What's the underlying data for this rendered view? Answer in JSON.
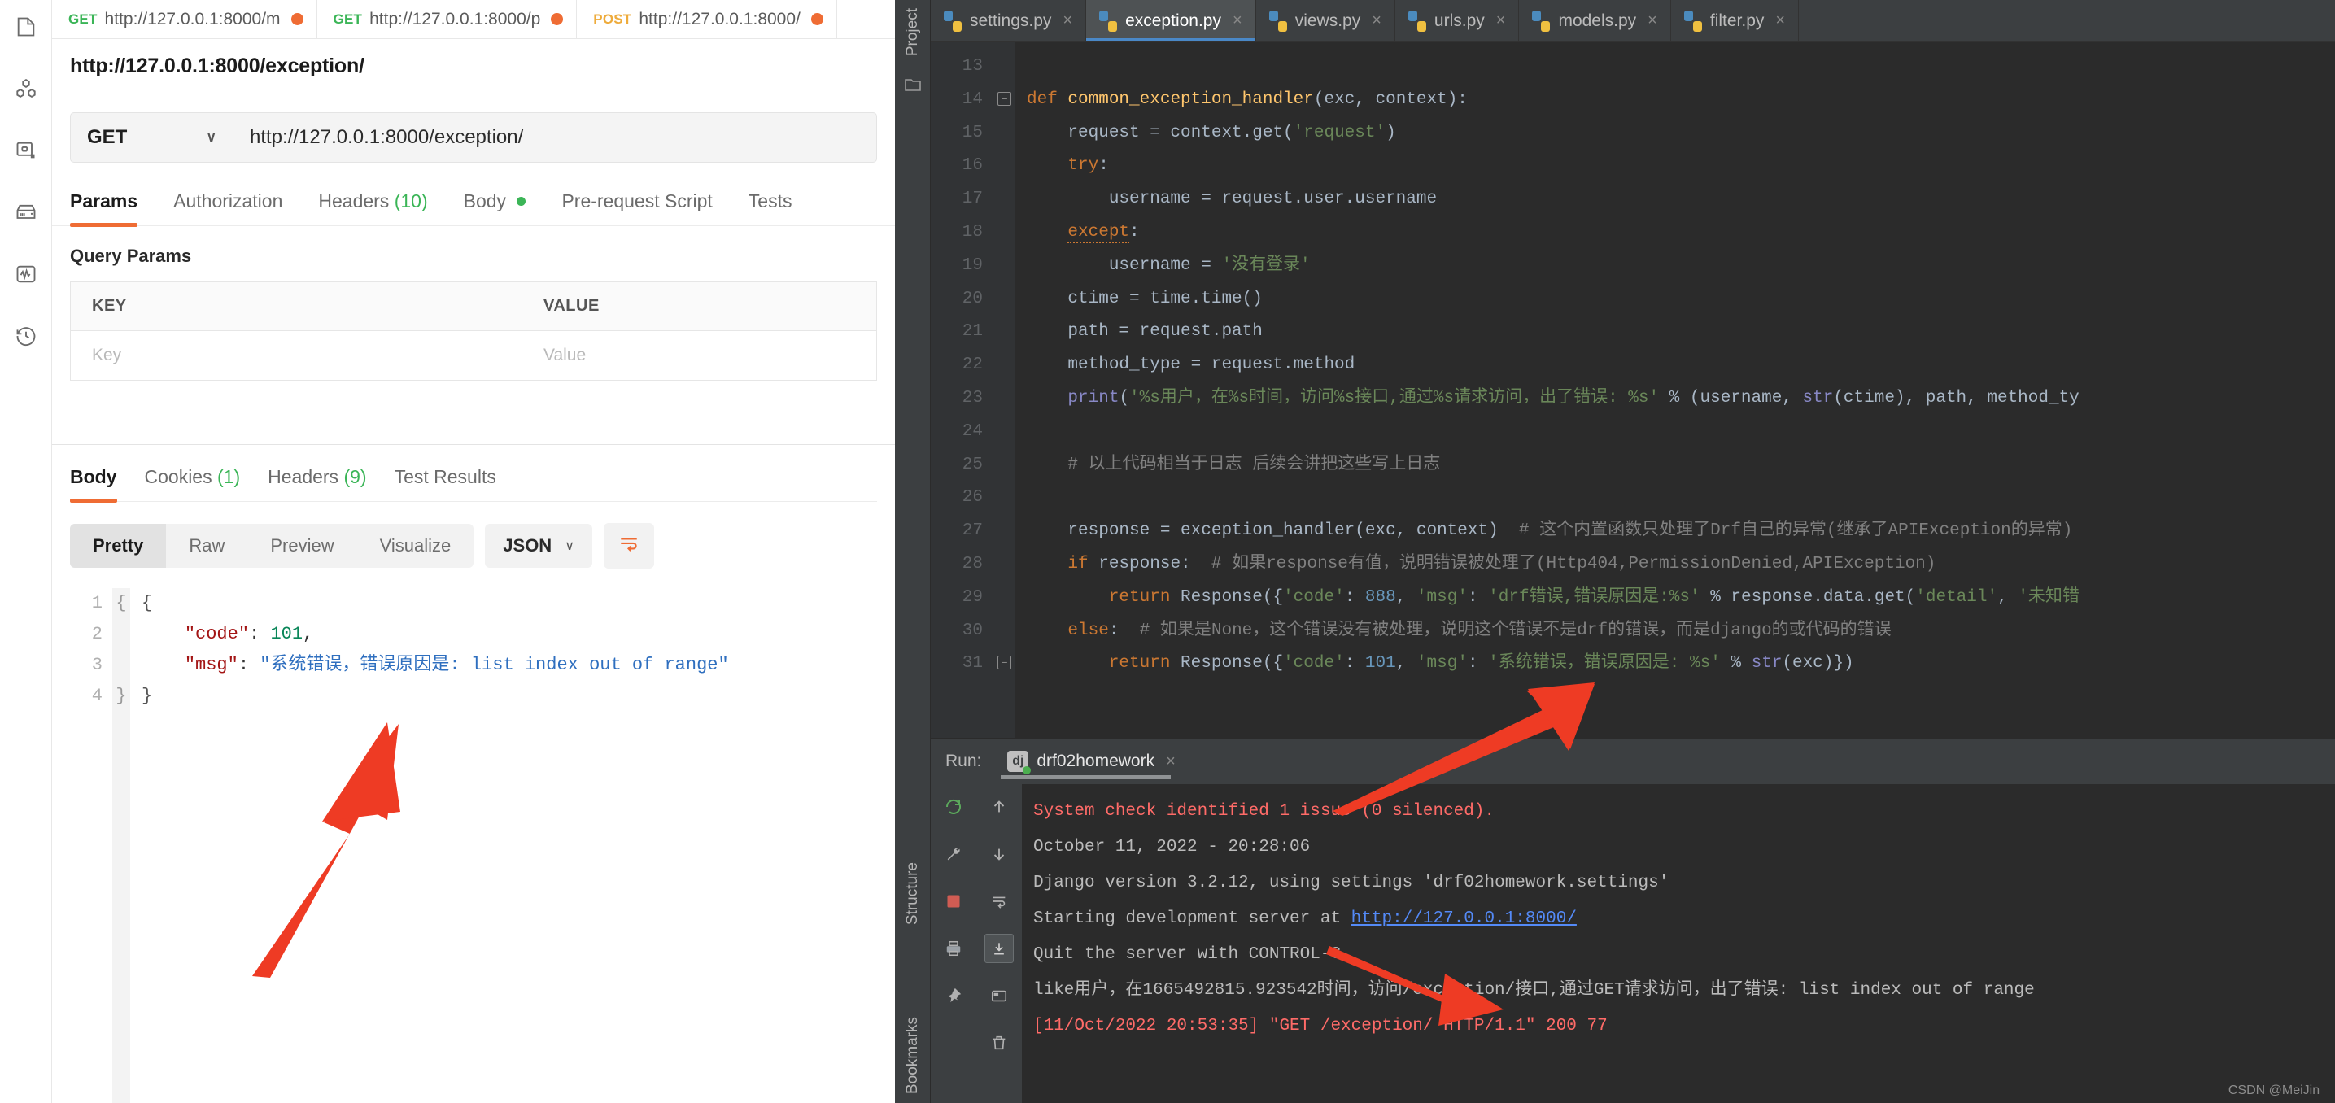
{
  "postman": {
    "rail_icons": [
      "collections-icon",
      "apis-icon",
      "environments-icon",
      "mock-servers-icon",
      "monitors-icon",
      "history-icon"
    ],
    "tabs": [
      {
        "method": "GET",
        "url": "http://127.0.0.1:8000/m",
        "unsaved": true
      },
      {
        "method": "GET",
        "url": "http://127.0.0.1:8000/p",
        "unsaved": true
      },
      {
        "method": "POST",
        "url": "http://127.0.0.1:8000/",
        "unsaved": true
      }
    ],
    "request_title": "http://127.0.0.1:8000/exception/",
    "method": "GET",
    "method_caret": "∨",
    "url_value": "http://127.0.0.1:8000/exception/",
    "request_tabs": [
      {
        "label": "Params",
        "active": true
      },
      {
        "label": "Authorization",
        "active": false
      },
      {
        "label": "Headers",
        "count": "(10)",
        "active": false
      },
      {
        "label": "Body",
        "dot": true,
        "active": false
      },
      {
        "label": "Pre-request Script",
        "active": false
      },
      {
        "label": "Tests",
        "active": false
      }
    ],
    "query_params_label": "Query Params",
    "table": {
      "headers": [
        "KEY",
        "VALUE"
      ],
      "rows": [
        [
          "Key",
          "Value"
        ]
      ]
    },
    "response_tabs": [
      {
        "label": "Body",
        "active": true
      },
      {
        "label": "Cookies",
        "count": "(1)",
        "active": false
      },
      {
        "label": "Headers",
        "count": "(9)",
        "active": false
      },
      {
        "label": "Test Results",
        "active": false
      }
    ],
    "view_modes": [
      "Pretty",
      "Raw",
      "Preview",
      "Visualize"
    ],
    "view_mode_active": "Pretty",
    "format": "JSON",
    "format_caret": "∨",
    "wrap_icon": "wrap-lines-icon",
    "json_lines": [
      "1",
      "2",
      "3",
      "4"
    ],
    "json_body": {
      "line1": "{",
      "line2_key": "\"code\"",
      "line2_colon": ": ",
      "line2_val": "101",
      "line2_comma": ",",
      "line3_key": "\"msg\"",
      "line3_colon": ": ",
      "line3_val": "\"系统错误，错误原因是: list index out of range\"",
      "line4": "}"
    }
  },
  "pycharm": {
    "left_strip": {
      "project_label": "Project",
      "structure_label": "Structure",
      "bookmarks_label": "Bookmarks"
    },
    "editor_tabs": [
      {
        "name": "settings.py",
        "active": false
      },
      {
        "name": "exception.py",
        "active": true
      },
      {
        "name": "views.py",
        "active": false
      },
      {
        "name": "urls.py",
        "active": false
      },
      {
        "name": "models.py",
        "active": false
      },
      {
        "name": "filter.py",
        "active": false
      }
    ],
    "tab_close_glyph": "×",
    "code_lines": [
      {
        "n": "13",
        "tokens": []
      },
      {
        "n": "14",
        "fold": true,
        "tokens": [
          {
            "t": "def ",
            "c": "kw"
          },
          {
            "t": "common_exception_handler",
            "c": "fn"
          },
          {
            "t": "(exc, context):",
            "c": "pl"
          }
        ]
      },
      {
        "n": "15",
        "tokens": [
          {
            "t": "    request = context.get(",
            "c": "pl"
          },
          {
            "t": "'request'",
            "c": "str"
          },
          {
            "t": ")",
            "c": "pl"
          }
        ]
      },
      {
        "n": "16",
        "tokens": [
          {
            "t": "    ",
            "c": "pl"
          },
          {
            "t": "try",
            "c": "kw"
          },
          {
            "t": ":",
            "c": "pl"
          }
        ]
      },
      {
        "n": "17",
        "tokens": [
          {
            "t": "        username = request.user.username",
            "c": "pl"
          }
        ]
      },
      {
        "n": "18",
        "tokens": [
          {
            "t": "    ",
            "c": "pl"
          },
          {
            "t": "except",
            "c": "kw wav"
          },
          {
            "t": ":",
            "c": "pl"
          }
        ]
      },
      {
        "n": "19",
        "tokens": [
          {
            "t": "        username = ",
            "c": "pl"
          },
          {
            "t": "'没有登录'",
            "c": "str"
          }
        ]
      },
      {
        "n": "20",
        "tokens": [
          {
            "t": "    ctime = time.time()",
            "c": "pl"
          }
        ]
      },
      {
        "n": "21",
        "tokens": [
          {
            "t": "    path = request.path",
            "c": "pl"
          }
        ]
      },
      {
        "n": "22",
        "tokens": [
          {
            "t": "    method_type = request.method",
            "c": "pl"
          }
        ]
      },
      {
        "n": "23",
        "tokens": [
          {
            "t": "    ",
            "c": "pl"
          },
          {
            "t": "print",
            "c": "bi"
          },
          {
            "t": "(",
            "c": "pl"
          },
          {
            "t": "'%s用户，在%s时间，访问%s接口,通过%s请求访问，出了错误: %s'",
            "c": "str"
          },
          {
            "t": " % (username, ",
            "c": "pl"
          },
          {
            "t": "str",
            "c": "bi"
          },
          {
            "t": "(ctime), path, method_ty",
            "c": "pl"
          }
        ]
      },
      {
        "n": "24",
        "tokens": []
      },
      {
        "n": "25",
        "tokens": [
          {
            "t": "    # 以上代码相当于日志 后续会讲把这些写上日志",
            "c": "cmt"
          }
        ]
      },
      {
        "n": "26",
        "tokens": []
      },
      {
        "n": "27",
        "tokens": [
          {
            "t": "    response = exception_handler(exc, context)  ",
            "c": "pl"
          },
          {
            "t": "# 这个内置函数只处理了Drf自己的异常(继承了APIException的异常)",
            "c": "cmt"
          }
        ]
      },
      {
        "n": "28",
        "tokens": [
          {
            "t": "    ",
            "c": "pl"
          },
          {
            "t": "if",
            "c": "kw"
          },
          {
            "t": " response:  ",
            "c": "pl"
          },
          {
            "t": "# 如果response有值，说明错误被处理了(Http404,PermissionDenied,APIException)",
            "c": "cmt"
          }
        ]
      },
      {
        "n": "29",
        "tokens": [
          {
            "t": "        ",
            "c": "pl"
          },
          {
            "t": "return",
            "c": "kw"
          },
          {
            "t": " Response({",
            "c": "pl"
          },
          {
            "t": "'code'",
            "c": "str"
          },
          {
            "t": ": ",
            "c": "pl"
          },
          {
            "t": "888",
            "c": "num"
          },
          {
            "t": ", ",
            "c": "pl"
          },
          {
            "t": "'msg'",
            "c": "str"
          },
          {
            "t": ": ",
            "c": "pl"
          },
          {
            "t": "'drf错误,错误原因是:%s'",
            "c": "str"
          },
          {
            "t": " % response.data.get(",
            "c": "pl"
          },
          {
            "t": "'detail'",
            "c": "str"
          },
          {
            "t": ", ",
            "c": "pl"
          },
          {
            "t": "'未知错",
            "c": "str"
          }
        ]
      },
      {
        "n": "30",
        "tokens": [
          {
            "t": "    ",
            "c": "pl"
          },
          {
            "t": "else",
            "c": "kw"
          },
          {
            "t": ":  ",
            "c": "pl"
          },
          {
            "t": "# 如果是None，这个错误没有被处理，说明这个错误不是drf的错误，而是django的或代码的错误",
            "c": "cmt"
          }
        ]
      },
      {
        "n": "31",
        "fold2": true,
        "tokens": [
          {
            "t": "        ",
            "c": "pl"
          },
          {
            "t": "return",
            "c": "kw"
          },
          {
            "t": " Response({",
            "c": "pl"
          },
          {
            "t": "'code'",
            "c": "str"
          },
          {
            "t": ": ",
            "c": "pl"
          },
          {
            "t": "101",
            "c": "num"
          },
          {
            "t": ", ",
            "c": "pl"
          },
          {
            "t": "'msg'",
            "c": "str"
          },
          {
            "t": ": ",
            "c": "pl"
          },
          {
            "t": "'系统错误，错误原因是: %s'",
            "c": "str"
          },
          {
            "t": " % ",
            "c": "pl"
          },
          {
            "t": "str",
            "c": "bi"
          },
          {
            "t": "(exc)})",
            "c": "pl"
          }
        ]
      }
    ],
    "run_panel": {
      "label": "Run:",
      "config_name": "drf02homework",
      "config_icon": "django-icon",
      "close_glyph": "×",
      "tool_icons": [
        "rerun-icon",
        "up-arrow-icon",
        "wrench-icon",
        "down-arrow-icon",
        "stop-icon",
        "soft-wrap-icon",
        "print-icon",
        "scroll-to-end-icon",
        "camera-icon",
        "pin-icon",
        "trash-icon"
      ],
      "console_lines": [
        {
          "text": "System check identified 1 issue (0 silenced).",
          "style": "err"
        },
        {
          "text": "October 11, 2022 - 20:28:06",
          "style": "normal"
        },
        {
          "text": "Django version 3.2.12, using settings 'drf02homework.settings'",
          "style": "normal"
        },
        {
          "text": "Starting development server at ",
          "style": "normal",
          "link": "http://127.0.0.1:8000/"
        },
        {
          "text": "Quit the server with CONTROL-C.",
          "style": "normal"
        },
        {
          "text": "like用户，在1665492815.923542时间，访问/exception/接口,通过GET请求访问，出了错误: list index out of range",
          "style": "normal"
        },
        {
          "text": "[11/Oct/2022 20:53:35] \"GET /exception/ HTTP/1.1\" 200 77",
          "style": "err"
        }
      ]
    }
  },
  "watermark": "CSDN @MeiJin_",
  "colors": {
    "accent_orange": "#ef6c34",
    "green": "#3bb557",
    "arrow_red": "#ee3b24",
    "ide_bg": "#2b2b2b",
    "ide_chrome": "#3c3f41"
  }
}
